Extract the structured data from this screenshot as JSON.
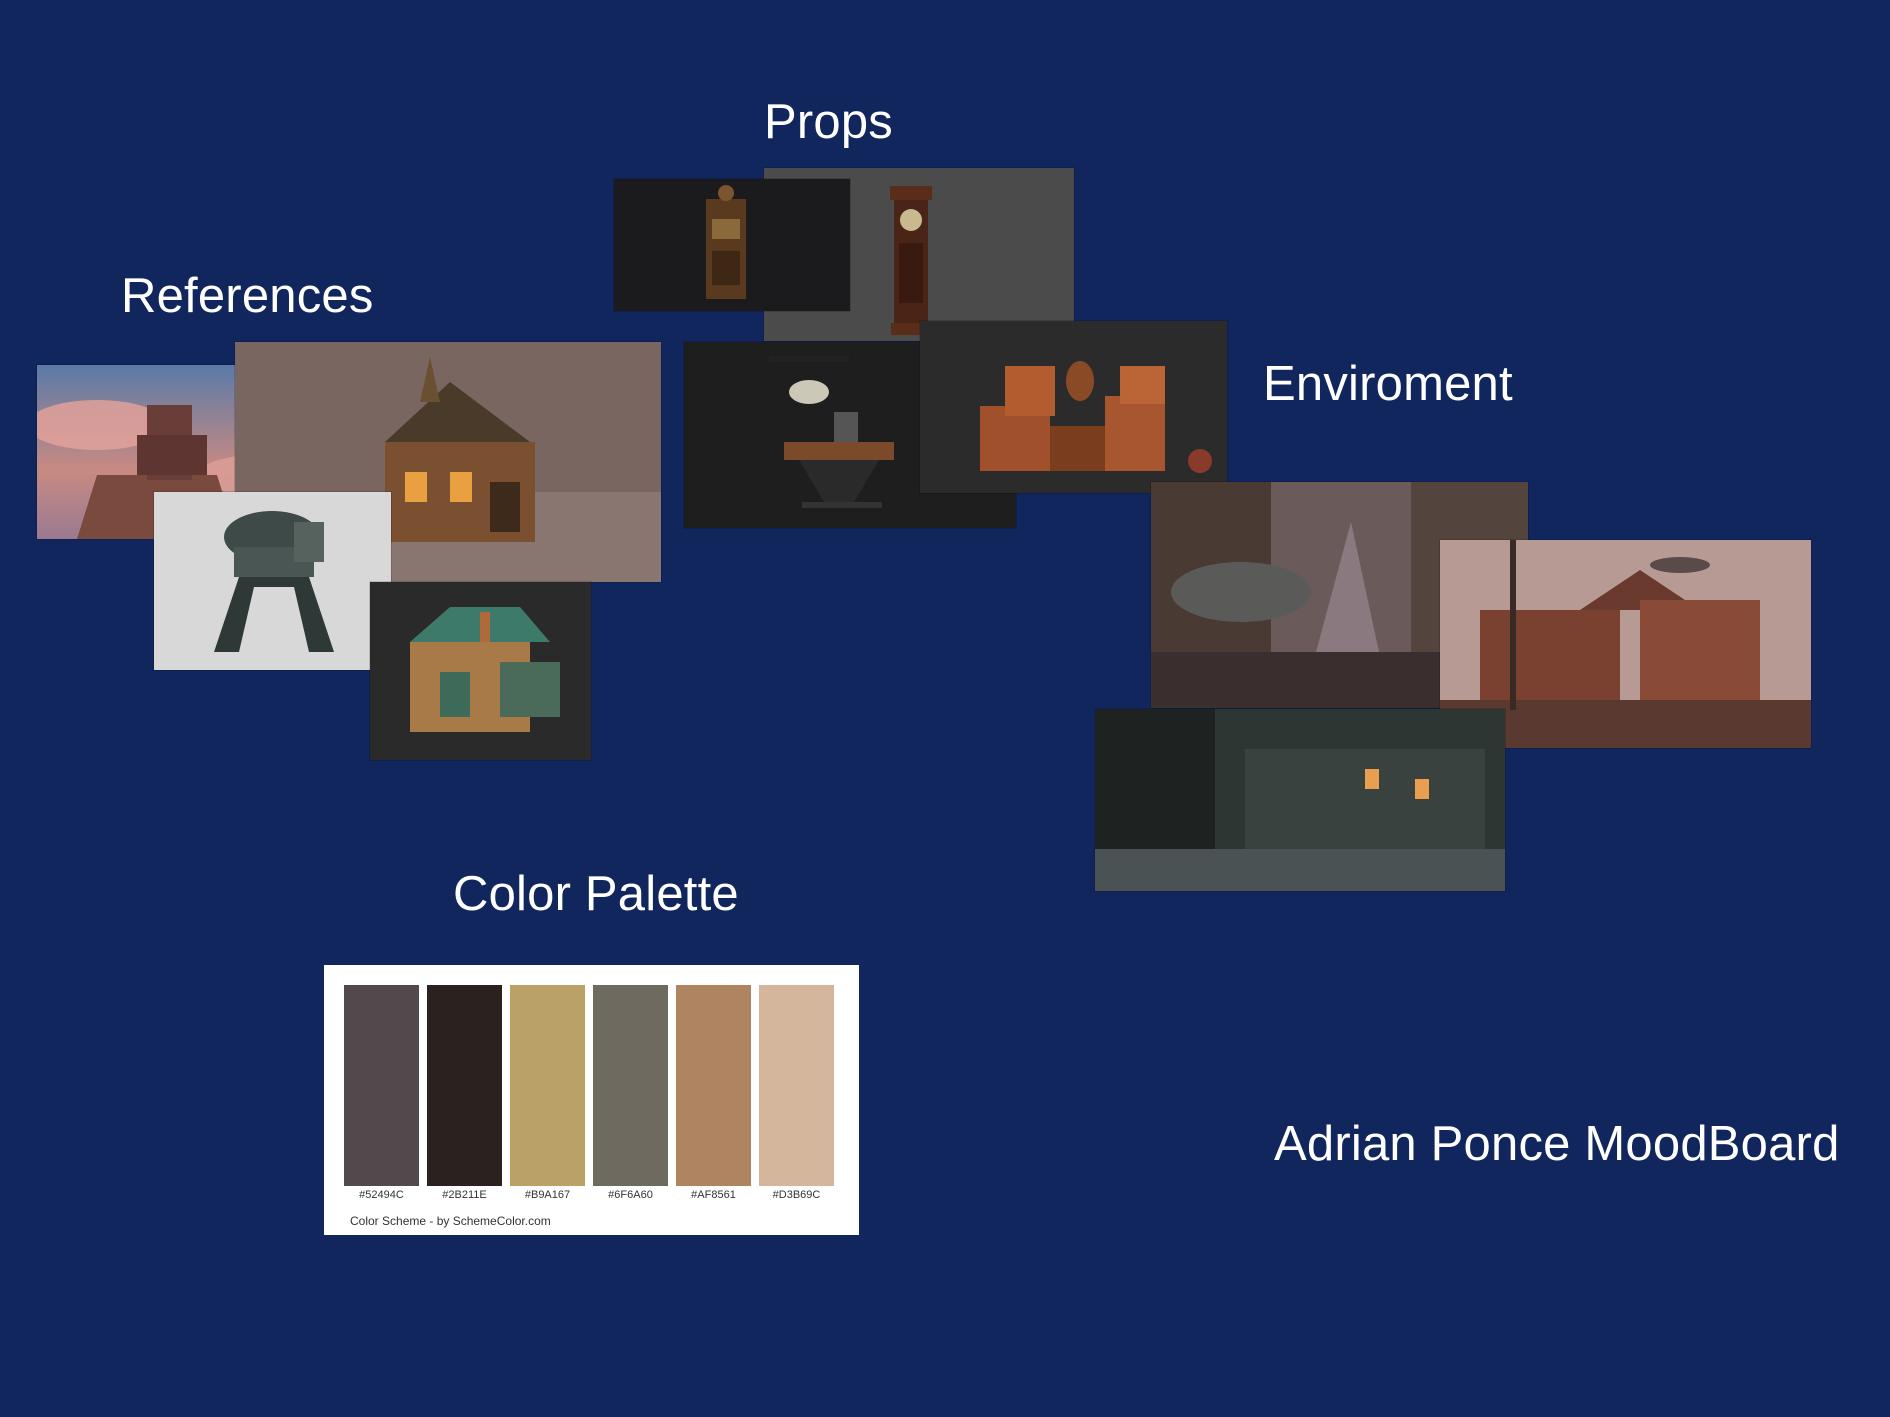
{
  "headings": {
    "props": "Props",
    "references": "References",
    "enviroment": "Enviroment",
    "color_palette": "Color Palette",
    "author": "Adrian Ponce MoodBoard"
  },
  "palette": {
    "swatches": [
      {
        "color": "#52494C",
        "label": "#52494C"
      },
      {
        "color": "#2B211E",
        "label": "#2B211E"
      },
      {
        "color": "#B9A167",
        "label": "#B9A167"
      },
      {
        "color": "#6F6A60",
        "label": "#6F6A60"
      },
      {
        "color": "#AF8561",
        "label": "#AF8561"
      },
      {
        "color": "#D3B69C",
        "label": "#D3B69C"
      }
    ],
    "credit": "Color Scheme - by SchemeColor.com"
  },
  "colors": {
    "background": "#12265E",
    "heading_text": "#FFFFFF"
  }
}
